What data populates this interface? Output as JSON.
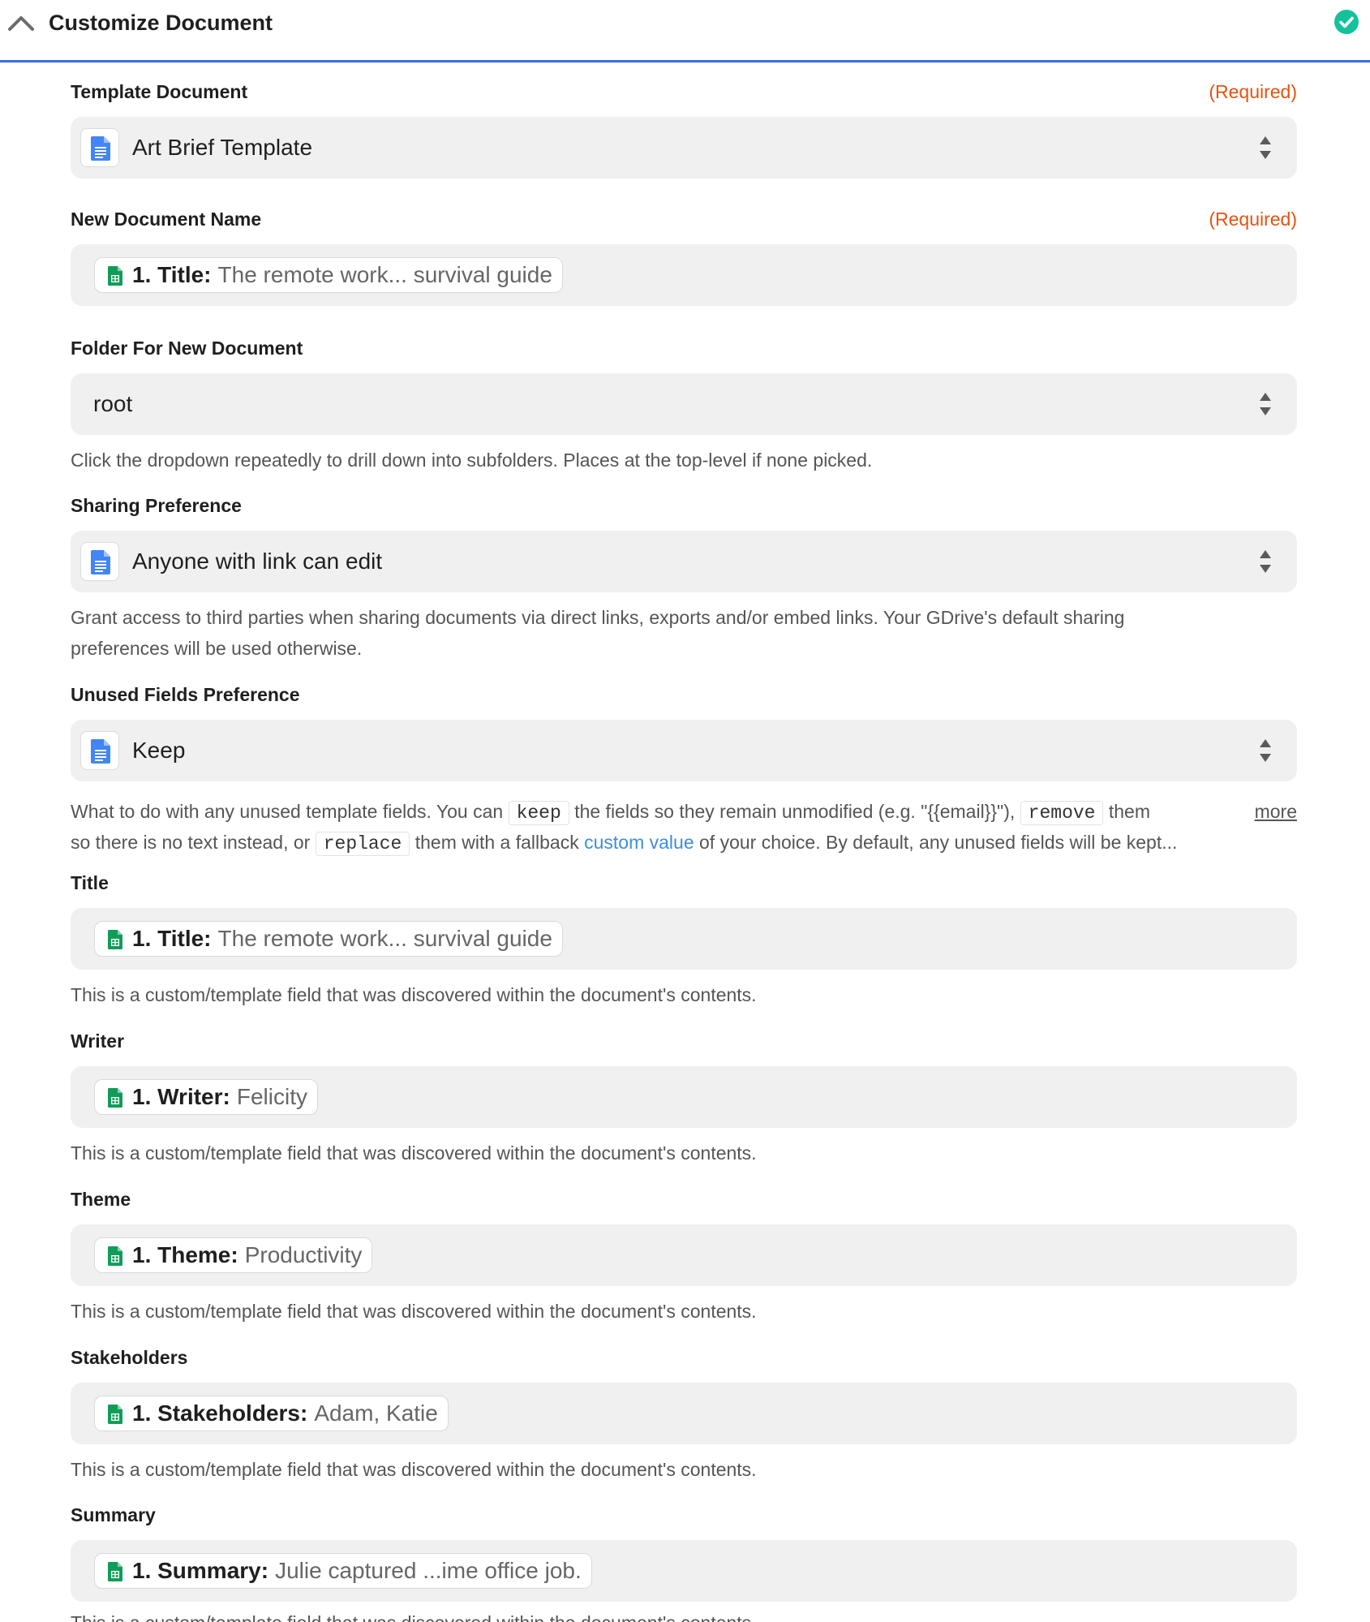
{
  "header": {
    "title": "Customize Document",
    "status": "complete"
  },
  "template_document": {
    "label": "Template Document",
    "required": "(Required)",
    "value": "Art Brief Template",
    "icon": "google-docs-icon"
  },
  "new_document_name": {
    "label": "New Document Name",
    "required": "(Required)",
    "pill_key": "1. Title:",
    "pill_value": "The remote work... survival guide",
    "icon": "google-sheets-icon"
  },
  "folder": {
    "label": "Folder For New Document",
    "value": "root",
    "help": "Click the dropdown repeatedly to drill down into subfolders. Places at the top-level if none picked."
  },
  "sharing": {
    "label": "Sharing Preference",
    "value": "Anyone with link can edit",
    "help_line1": "Grant access to third parties when sharing documents via direct links, exports and/or embed links. Your GDrive's default sharing",
    "help_line2": "preferences will be used otherwise."
  },
  "unused_fields": {
    "label": "Unused Fields Preference",
    "value": "Keep",
    "help": {
      "t1": "What to do with any unused template fields. You can",
      "code_keep": "keep",
      "t2": "the fields so they remain unmodified (e.g. \"{{email}}\"),",
      "code_remove": "remove",
      "t3": "them",
      "t4": "so there is no text instead, or",
      "code_replace": "replace",
      "t5": "them with a fallback",
      "link": "custom value",
      "t6": "of your choice. By default, any unused fields will be kept...",
      "more": "more"
    }
  },
  "custom_field_help": "This is a custom/template field that was discovered within the document's contents.",
  "custom_fields": [
    {
      "label": "Title",
      "pill_key": "1. Title:",
      "pill_value": "The remote work... survival guide"
    },
    {
      "label": "Writer",
      "pill_key": "1. Writer:",
      "pill_value": "Felicity"
    },
    {
      "label": "Theme",
      "pill_key": "1. Theme:",
      "pill_value": "Productivity"
    },
    {
      "label": "Stakeholders",
      "pill_key": "1. Stakeholders:",
      "pill_value": "Adam, Katie"
    },
    {
      "label": "Summary",
      "pill_key": "1. Summary:",
      "pill_value": "Julie captured ...ime office job."
    }
  ],
  "colors": {
    "accent_blue": "#3b6fde",
    "required_orange": "#e8530e",
    "success_green": "#13c29a",
    "docs_blue": "#4285f4",
    "sheets_green": "#0f9d58",
    "field_bg": "#f0f0f1"
  }
}
